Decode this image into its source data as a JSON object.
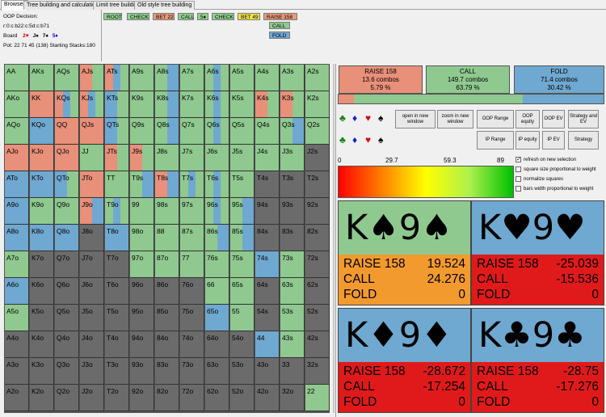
{
  "tabs": [
    "Browser",
    "Tree building and calculation",
    "Limit tree building",
    "Old style tree building"
  ],
  "info": {
    "decision": "OOP Decision:",
    "line": "r:0:c:b22:c:5d:c:b71",
    "board_label": "Board",
    "board": [
      {
        "text": "2♥",
        "color": "#e00000"
      },
      {
        "text": "J♠",
        "color": "#000000"
      },
      {
        "text": "7♠",
        "color": "#000000"
      },
      {
        "text": "5♦",
        "color": "#0000e0"
      }
    ],
    "pot": "Pot: 22 71 45 (138) Starting Stacks:180"
  },
  "tree": [
    {
      "label": "ROOT",
      "color": "#8fd18f"
    },
    {
      "label": "CHECK",
      "color": "#8fd18f"
    },
    {
      "label": "BET 22",
      "color": "#e89a7a"
    },
    {
      "label": "CALL",
      "color": "#8fd18f"
    },
    {
      "label": "5♦",
      "color": "#8fd18f"
    },
    {
      "label": "CHECK",
      "color": "#8fd18f"
    },
    {
      "label": "BET 49",
      "color": "#f2e14a"
    },
    {
      "label": "RAISE 158",
      "color": "#e89a7a"
    },
    {
      "label": "CALL",
      "color": "#8fc98f"
    },
    {
      "label": "FOLD",
      "color": "#6fa8d8"
    }
  ],
  "colors": {
    "raise": "#e8907a",
    "call": "#8fc98f",
    "fold": "#6fa8d0",
    "empty": "#6b6b6b"
  },
  "grid": [
    [
      [
        "AA",
        "c"
      ],
      [
        "AKs",
        "c"
      ],
      [
        "AQs",
        "c"
      ],
      [
        "AJs",
        "rc"
      ],
      [
        "ATs",
        "rfc"
      ],
      [
        "A9s",
        "c"
      ],
      [
        "A8s",
        "cf"
      ],
      [
        "A7s",
        "c"
      ],
      [
        "A6s",
        "cfc"
      ],
      [
        "A5s",
        "c"
      ],
      [
        "A4s",
        "c"
      ],
      [
        "A3s",
        "c"
      ],
      [
        "A2s",
        "c"
      ]
    ],
    [
      [
        "AKo",
        "c"
      ],
      [
        "KK",
        "r"
      ],
      [
        "KQs",
        "rfc"
      ],
      [
        "KJs",
        "rfc"
      ],
      [
        "KTs",
        "fc"
      ],
      [
        "K9s",
        "c"
      ],
      [
        "K8s",
        "cf"
      ],
      [
        "K7s",
        "c"
      ],
      [
        "K6s",
        "cfc"
      ],
      [
        "K5s",
        "c"
      ],
      [
        "K4s",
        "rc"
      ],
      [
        "K3s",
        "rc"
      ],
      [
        "K2s",
        "c"
      ]
    ],
    [
      [
        "AQo",
        "c"
      ],
      [
        "KQo",
        "f"
      ],
      [
        "QQ",
        "r"
      ],
      [
        "QJs",
        "r"
      ],
      [
        "QTs",
        "fc"
      ],
      [
        "Q9s",
        "c"
      ],
      [
        "Q8s",
        "cf"
      ],
      [
        "Q7s",
        "c"
      ],
      [
        "Q6s",
        "cfc"
      ],
      [
        "Q5s",
        "c"
      ],
      [
        "Q4s",
        "c"
      ],
      [
        "Q3s",
        "cf"
      ],
      [
        "Q2s",
        "c"
      ]
    ],
    [
      [
        "AJo",
        "r"
      ],
      [
        "KJo",
        "r"
      ],
      [
        "QJo",
        "r"
      ],
      [
        "JJ",
        "c"
      ],
      [
        "JTs",
        "rc"
      ],
      [
        "J9s",
        "rc"
      ],
      [
        "J8s",
        "c"
      ],
      [
        "J7s",
        "c"
      ],
      [
        "J6s",
        "c"
      ],
      [
        "J5s",
        "c"
      ],
      [
        "J4s",
        "c"
      ],
      [
        "J3s",
        "c"
      ],
      [
        "J2s",
        "e"
      ]
    ],
    [
      [
        "ATo",
        "f"
      ],
      [
        "KTo",
        "f"
      ],
      [
        "QTo",
        "fc"
      ],
      [
        "JTo",
        "r"
      ],
      [
        "TT",
        "c"
      ],
      [
        "T9s",
        "cf"
      ],
      [
        "T8s",
        "rf"
      ],
      [
        "T7s",
        "cfc"
      ],
      [
        "T6s",
        "cfc"
      ],
      [
        "T5s",
        "c"
      ],
      [
        "T4s",
        "e"
      ],
      [
        "T3s",
        "e"
      ],
      [
        "T2s",
        "e"
      ]
    ],
    [
      [
        "A9o",
        "f"
      ],
      [
        "K9o",
        "c"
      ],
      [
        "Q9o",
        "c"
      ],
      [
        "J9o",
        "rf"
      ],
      [
        "T9o",
        "cfc"
      ],
      [
        "99",
        "c"
      ],
      [
        "98s",
        "c"
      ],
      [
        "97s",
        "c"
      ],
      [
        "96s",
        "cfc"
      ],
      [
        "95s",
        "cf"
      ],
      [
        "94s",
        "e"
      ],
      [
        "93s",
        "e"
      ],
      [
        "92s",
        "e"
      ]
    ],
    [
      [
        "A8o",
        "f"
      ],
      [
        "K8o",
        "f"
      ],
      [
        "Q8o",
        "f"
      ],
      [
        "J8o",
        "e"
      ],
      [
        "T8o",
        "f"
      ],
      [
        "98o",
        "c"
      ],
      [
        "88",
        "c"
      ],
      [
        "87s",
        "c"
      ],
      [
        "86s",
        "cf"
      ],
      [
        "85s",
        "cf"
      ],
      [
        "84s",
        "e"
      ],
      [
        "83s",
        "e"
      ],
      [
        "82s",
        "e"
      ]
    ],
    [
      [
        "A7o",
        "c"
      ],
      [
        "K7o",
        "e"
      ],
      [
        "Q7o",
        "e"
      ],
      [
        "J7o",
        "e"
      ],
      [
        "T7o",
        "e"
      ],
      [
        "97o",
        "c"
      ],
      [
        "87o",
        "c"
      ],
      [
        "77",
        "c"
      ],
      [
        "76s",
        "c"
      ],
      [
        "75s",
        "c"
      ],
      [
        "74s",
        "f"
      ],
      [
        "73s",
        "c"
      ],
      [
        "72s",
        "e"
      ]
    ],
    [
      [
        "A6o",
        "f"
      ],
      [
        "K6o",
        "e"
      ],
      [
        "Q6o",
        "e"
      ],
      [
        "J6o",
        "e"
      ],
      [
        "T6o",
        "e"
      ],
      [
        "96o",
        "e"
      ],
      [
        "86o",
        "e"
      ],
      [
        "76o",
        "e"
      ],
      [
        "66",
        "c"
      ],
      [
        "65s",
        "c"
      ],
      [
        "64s",
        "e"
      ],
      [
        "63s",
        "c"
      ],
      [
        "62s",
        "e"
      ]
    ],
    [
      [
        "A5o",
        "c"
      ],
      [
        "K5o",
        "e"
      ],
      [
        "Q5o",
        "e"
      ],
      [
        "J5o",
        "e"
      ],
      [
        "T5o",
        "e"
      ],
      [
        "95o",
        "e"
      ],
      [
        "85o",
        "e"
      ],
      [
        "75o",
        "e"
      ],
      [
        "65o",
        "f"
      ],
      [
        "55",
        "c"
      ],
      [
        "54s",
        "e"
      ],
      [
        "53s",
        "c"
      ],
      [
        "52s",
        "e"
      ]
    ],
    [
      [
        "A4o",
        "e"
      ],
      [
        "K4o",
        "e"
      ],
      [
        "Q4o",
        "e"
      ],
      [
        "J4o",
        "e"
      ],
      [
        "T4o",
        "e"
      ],
      [
        "94o",
        "e"
      ],
      [
        "84o",
        "e"
      ],
      [
        "74o",
        "e"
      ],
      [
        "64o",
        "e"
      ],
      [
        "54o",
        "e"
      ],
      [
        "44",
        "f"
      ],
      [
        "43s",
        "c"
      ],
      [
        "42s",
        "e"
      ]
    ],
    [
      [
        "A3o",
        "e"
      ],
      [
        "K3o",
        "e"
      ],
      [
        "Q3o",
        "e"
      ],
      [
        "J3o",
        "e"
      ],
      [
        "T3o",
        "e"
      ],
      [
        "93o",
        "e"
      ],
      [
        "83o",
        "e"
      ],
      [
        "73o",
        "e"
      ],
      [
        "63o",
        "e"
      ],
      [
        "53o",
        "e"
      ],
      [
        "43o",
        "e"
      ],
      [
        "33",
        "e"
      ],
      [
        "32s",
        "e"
      ]
    ],
    [
      [
        "A2o",
        "e"
      ],
      [
        "K2o",
        "e"
      ],
      [
        "Q2o",
        "e"
      ],
      [
        "J2o",
        "e"
      ],
      [
        "T2o",
        "e"
      ],
      [
        "92o",
        "e"
      ],
      [
        "82o",
        "e"
      ],
      [
        "72o",
        "e"
      ],
      [
        "62o",
        "e"
      ],
      [
        "52o",
        "e"
      ],
      [
        "42o",
        "e"
      ],
      [
        "32o",
        "e"
      ],
      [
        "22",
        "c"
      ]
    ]
  ],
  "actions": [
    {
      "name": "RAISE 158",
      "combos": "13.6 combos",
      "pct": "5.79 %",
      "share": 0.0579,
      "color": "#e8907a"
    },
    {
      "name": "CALL",
      "combos": "149.7 combos",
      "pct": "63.79 %",
      "share": 0.6379,
      "color": "#8fc98f"
    },
    {
      "name": "FOLD",
      "combos": "71.4 combos",
      "pct": "30.42 %",
      "share": 0.3042,
      "color": "#6fa8d0"
    }
  ],
  "buttons": {
    "open_window": "open in new window",
    "zoom_window": "zoom in new window",
    "oop_range": "OOP Range",
    "oop_equity": "OOP equity",
    "oop_ev": "OOP EV",
    "strategy_ev": "Strategy and EV",
    "ip_range": "IP Range",
    "ip_equity": "IP equity",
    "ip_ev": "IP EV",
    "strategy": "Strategy"
  },
  "suit_filters": [
    {
      "glyph": "♣",
      "color": "#108010"
    },
    {
      "glyph": "♦",
      "color": "#1020d0"
    },
    {
      "glyph": "♥",
      "color": "#d01010"
    },
    {
      "glyph": "♠",
      "color": "#000000"
    }
  ],
  "scale": [
    "0",
    "29.7",
    "59.3",
    "89"
  ],
  "checkboxes": [
    {
      "label": "refresh on new selection",
      "checked": true
    },
    {
      "label": "square size proportional to weight",
      "checked": false
    },
    {
      "label": "normalize squares",
      "checked": false
    },
    {
      "label": "bars width proportional to weight",
      "checked": false
    }
  ],
  "combos": [
    {
      "rank1": "K",
      "suit1": "♠",
      "rank2": "9",
      "suit2": "♠",
      "top_color": "#8fc98f",
      "bottom_color": "#f29a2e",
      "ev": [
        [
          "RAISE 158",
          "19.524"
        ],
        [
          "CALL",
          "24.276"
        ],
        [
          "FOLD",
          "0"
        ]
      ]
    },
    {
      "rank1": "K",
      "suit1": "♥",
      "rank2": "9",
      "suit2": "♥",
      "top_color": "#6fa8d0",
      "bottom_color": "#e01a1a",
      "ev": [
        [
          "RAISE 158",
          "-25.039"
        ],
        [
          "CALL",
          "-15.536"
        ],
        [
          "FOLD",
          "0"
        ]
      ]
    },
    {
      "rank1": "K",
      "suit1": "♦",
      "rank2": "9",
      "suit2": "♦",
      "top_color": "#6fa8d0",
      "bottom_color": "#e01a1a",
      "ev": [
        [
          "RAISE 158",
          "-28.672"
        ],
        [
          "CALL",
          "-17.254"
        ],
        [
          "FOLD",
          "0"
        ]
      ]
    },
    {
      "rank1": "K",
      "suit1": "♣",
      "rank2": "9",
      "suit2": "♣",
      "top_color": "#6fa8d0",
      "bottom_color": "#e01a1a",
      "ev": [
        [
          "RAISE 158",
          "-28.75"
        ],
        [
          "CALL",
          "-17.276"
        ],
        [
          "FOLD",
          "0"
        ]
      ]
    }
  ]
}
